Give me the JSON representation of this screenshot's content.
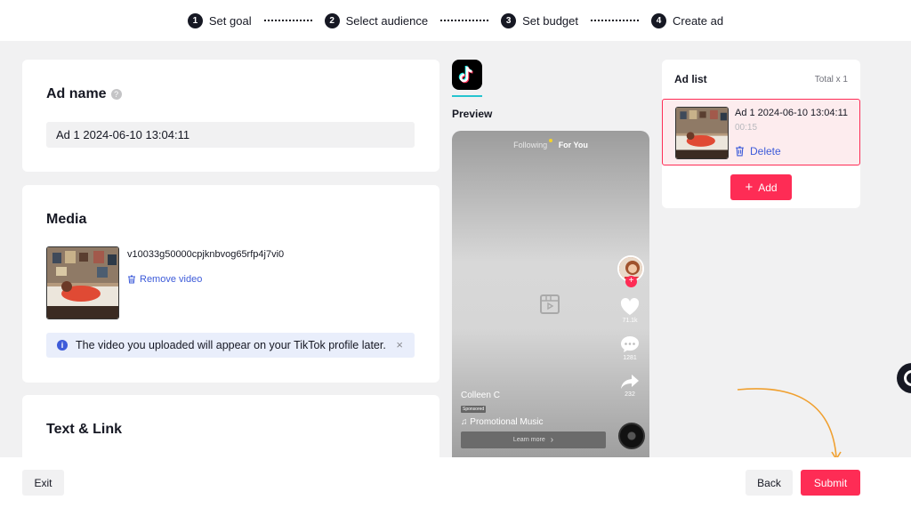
{
  "stepper": {
    "steps": [
      {
        "num": "1",
        "label": "Set goal"
      },
      {
        "num": "2",
        "label": "Select audience"
      },
      {
        "num": "3",
        "label": "Set budget"
      },
      {
        "num": "4",
        "label": "Create ad"
      }
    ]
  },
  "ad_name": {
    "title": "Ad name",
    "help": "?",
    "value": "Ad 1 2024-06-10 13:04:11"
  },
  "media": {
    "title": "Media",
    "video_name": "v10033g50000cpjknbvog65rfp4j7vi0",
    "remove_label": "Remove video",
    "notice": "The video you uploaded will appear on your TikTok profile later.",
    "notice_close": "×"
  },
  "text_link": {
    "title": "Text & Link"
  },
  "preview": {
    "label": "Preview",
    "tab_following": "Following",
    "tab_foryou": "For You",
    "likes": "71.1k",
    "comments": "1281",
    "shares": "232",
    "creator": "Colleen C",
    "sponsored": "Sponsored",
    "music": "♫ Promotional Music",
    "cta": "Learn more",
    "cta_arrow": "›"
  },
  "ad_list": {
    "title": "Ad list",
    "total": "Total x 1",
    "items": [
      {
        "name": "Ad 1 2024-06-10 13:04:11",
        "duration": "00:15",
        "delete_label": "Delete"
      }
    ],
    "add_label": "Add"
  },
  "footer": {
    "exit_label": "Exit",
    "back_label": "Back",
    "submit_label": "Submit"
  },
  "colors": {
    "accent": "#fe2c55",
    "link": "#3d5bd9",
    "annotation": "#f0a030"
  }
}
